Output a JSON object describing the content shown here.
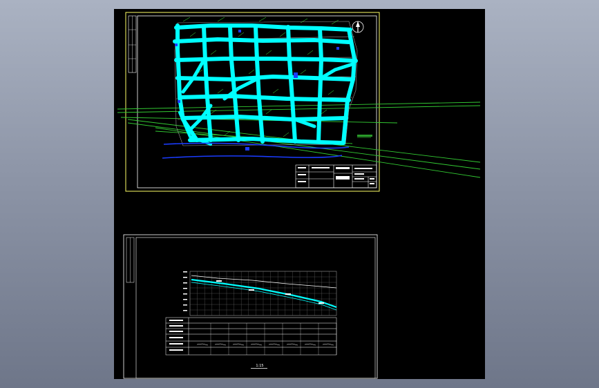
{
  "app": {
    "title": ""
  },
  "sheet1": {
    "title_block": {
      "drawing_title": "",
      "scale": ""
    },
    "north_arrow": "north-arrow"
  },
  "sheet2": {
    "scale_label": "1:15"
  },
  "colors": {
    "background": "#000000",
    "frame_yellow": "#ffff66",
    "frame_white": "#ffffff",
    "pipe_cyan": "#00ffff",
    "road_gray": "#9a9a9a",
    "line_green": "#33cc33",
    "river_blue": "#1a3cff",
    "annotation_green": "#44ff44",
    "desktop_gradient_top": "#aab2c2",
    "desktop_gradient_bottom": "#6e7689"
  }
}
